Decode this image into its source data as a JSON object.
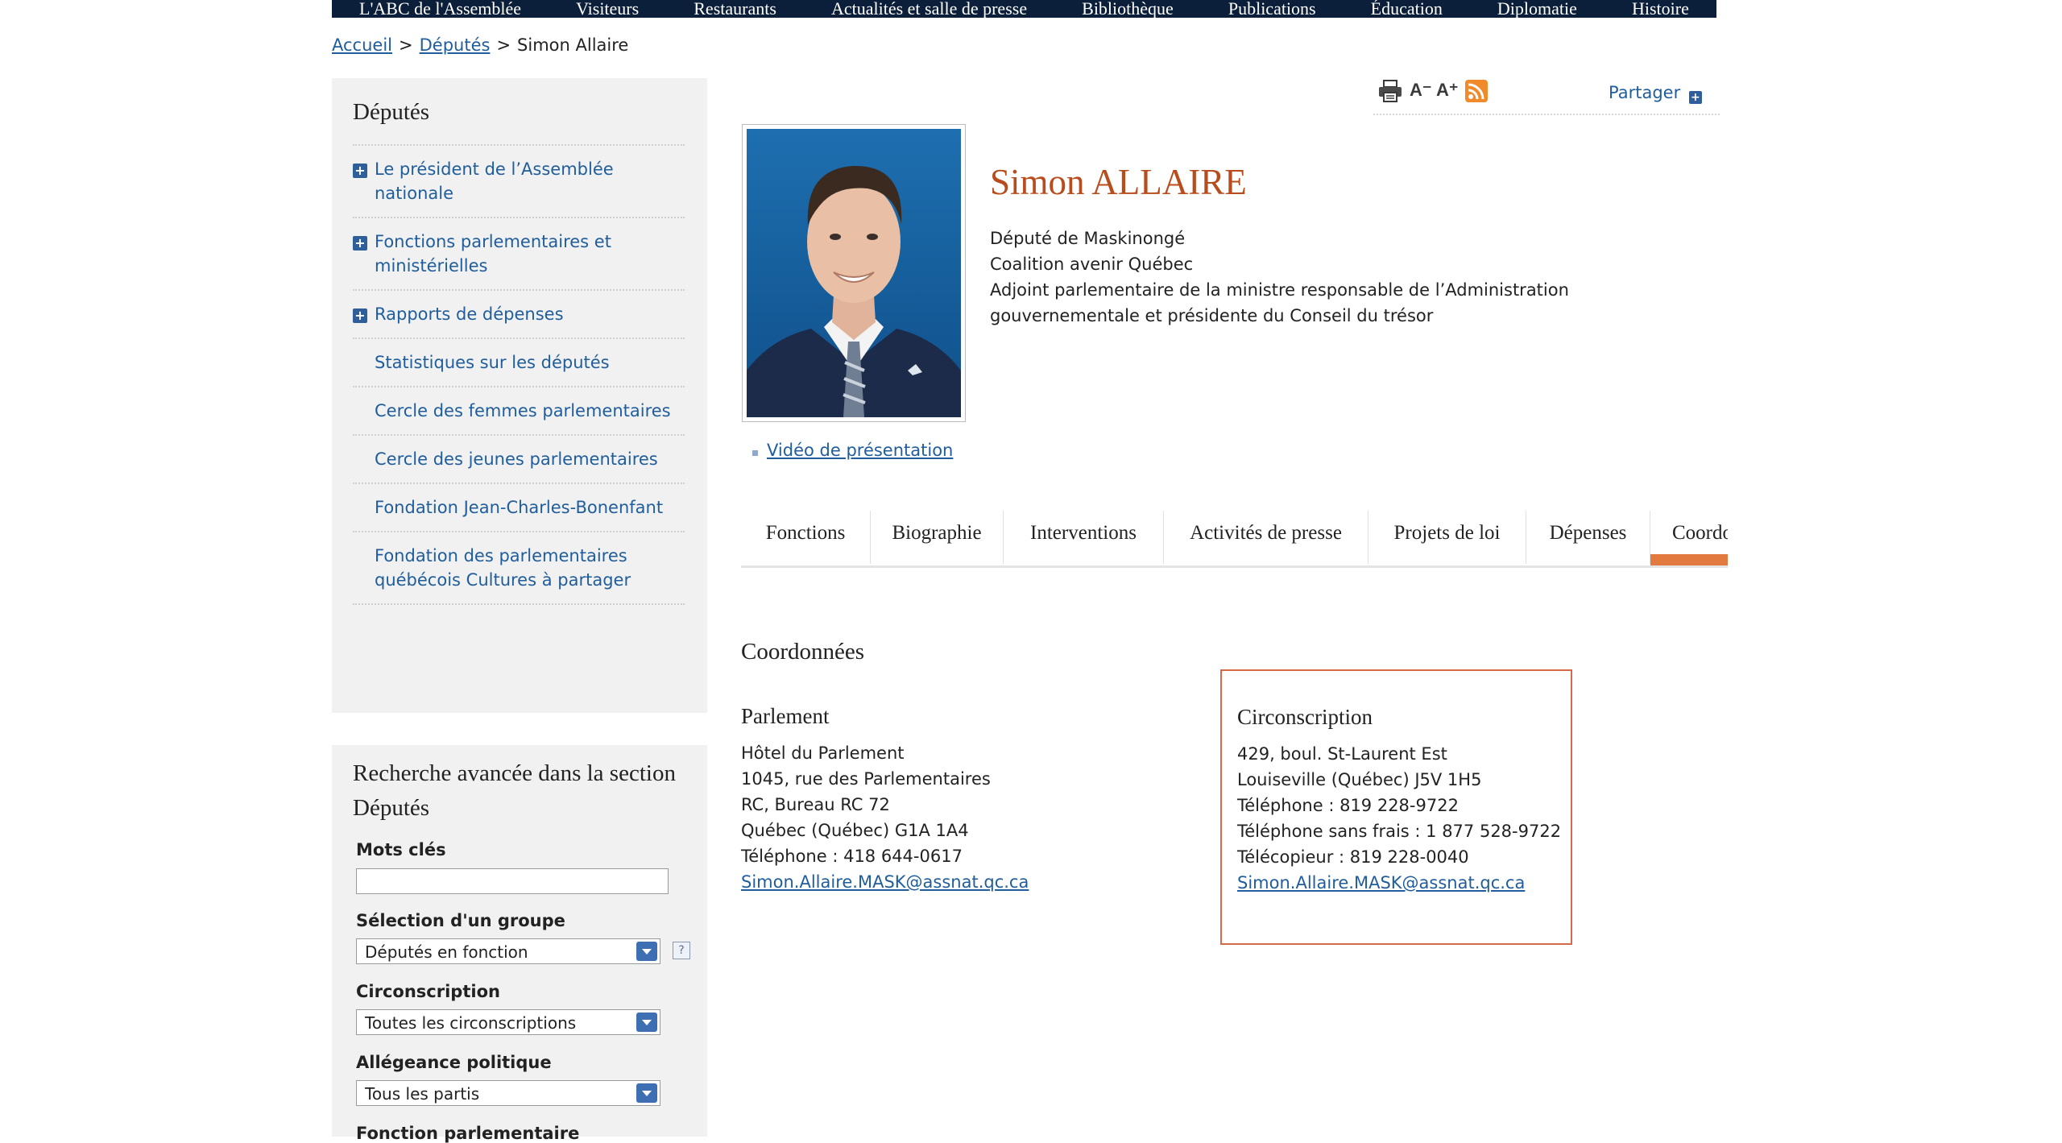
{
  "topnav": {
    "items": [
      "L'ABC de l'Assemblée",
      "Visiteurs",
      "Restaurants",
      "Actualités et salle de presse",
      "Bibliothèque",
      "Publications",
      "Éducation",
      "Diplomatie",
      "Histoire"
    ]
  },
  "breadcrumb": {
    "home": "Accueil",
    "section": "Députés",
    "current": "Simon Allaire",
    "separator": ">"
  },
  "sidebar": {
    "title": "Députés",
    "items": [
      {
        "label": "Le président de l’Assemblée nationale",
        "expandable": true
      },
      {
        "label": "Fonctions parlementaires et ministérielles",
        "expandable": true
      },
      {
        "label": "Rapports de dépenses",
        "expandable": true
      },
      {
        "label": "Statistiques sur les députés",
        "expandable": false
      },
      {
        "label": "Cercle des femmes parlementaires",
        "expandable": false
      },
      {
        "label": "Cercle des jeunes parlementaires",
        "expandable": false
      },
      {
        "label": "Fondation Jean-Charles-Bonenfant",
        "expandable": false
      },
      {
        "label": "Fondation des parlementaires québécois Cultures à partager",
        "expandable": false
      }
    ]
  },
  "search": {
    "title": "Recherche avancée dans la section Députés",
    "keywords_label": "Mots clés",
    "keywords_value": "",
    "group_label": "Sélection d'un groupe",
    "group_value": "Députés en fonction",
    "help_glyph": "?",
    "circ_label": "Circonscription",
    "circ_value": "Toutes les circonscriptions",
    "party_label": "Allégeance politique",
    "party_value": "Tous les partis",
    "function_label": "Fonction parlementaire"
  },
  "toolbar": {
    "font_decrease": "A⁻",
    "font_increase": "A⁺",
    "share_label": "Partager",
    "plus_glyph": "+",
    "rss_color": "#f08a2a"
  },
  "profile": {
    "name": "Simon ALLAIRE",
    "riding": "Député de Maskinongé",
    "party": "Coalition avenir Québec",
    "role": "Adjoint parlementaire de la ministre responsable de l’Administration gouvernementale et présidente du Conseil du trésor",
    "video_link": "Vidéo de présentation"
  },
  "tabs": [
    {
      "label": "Fonctions"
    },
    {
      "label": "Biographie"
    },
    {
      "label": "Interventions"
    },
    {
      "label": "Activités de presse"
    },
    {
      "label": "Projets de loi"
    },
    {
      "label": "Dépenses"
    },
    {
      "label": "Coordonnées",
      "active": true
    }
  ],
  "contact": {
    "title": "Coordonnées",
    "parlement": {
      "title": "Parlement",
      "lines": [
        "Hôtel du Parlement",
        "1045, rue des Parlementaires",
        "RC, Bureau RC 72",
        "Québec (Québec)  G1A 1A4",
        "Téléphone : 418 644-0617"
      ],
      "email": "Simon.Allaire.MASK@assnat.qc.ca"
    },
    "circonscription": {
      "title": "Circonscription",
      "lines": [
        "429, boul. St-Laurent Est",
        "Louiseville (Québec)  J5V 1H5",
        "Téléphone : 819 228-9722",
        "Téléphone sans frais : 1 877 528-9722",
        "Télécopieur : 819 228-0040"
      ],
      "email": "Simon.Allaire.MASK@assnat.qc.ca"
    }
  },
  "colors": {
    "nav_bg": "#0c1f3a",
    "link": "#1f5d9c",
    "name": "#b84c1c",
    "active_tab": "#e2793f",
    "highlight_border": "#d56a4a"
  }
}
